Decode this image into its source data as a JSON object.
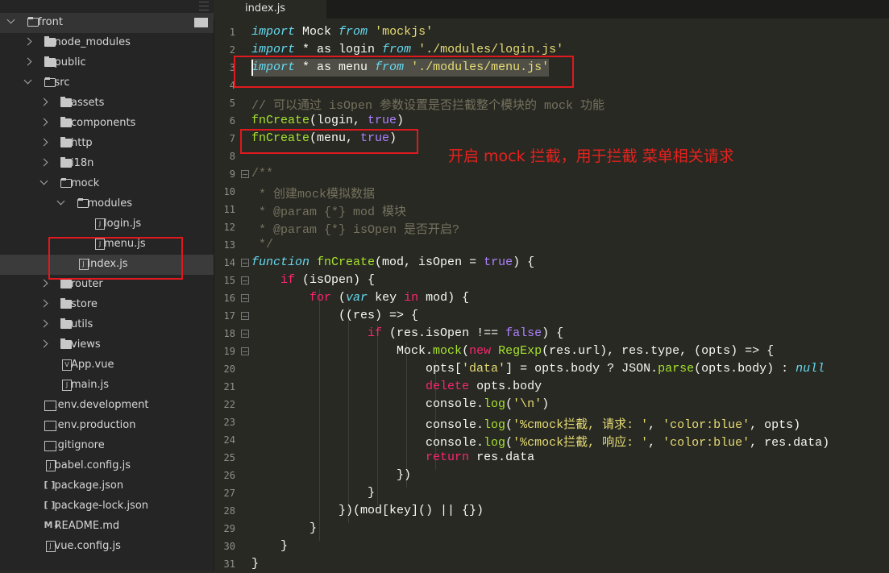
{
  "sidebar": {
    "items": [
      {
        "label": "front",
        "level": 0,
        "kind": "folder-open",
        "chev": "open",
        "state": "root"
      },
      {
        "label": "node_modules",
        "level": 1,
        "kind": "folder",
        "chev": "closed"
      },
      {
        "label": "public",
        "level": 1,
        "kind": "folder",
        "chev": "closed"
      },
      {
        "label": "src",
        "level": 1,
        "kind": "folder-open",
        "chev": "open"
      },
      {
        "label": "assets",
        "level": 2,
        "kind": "folder",
        "chev": "closed"
      },
      {
        "label": "components",
        "level": 2,
        "kind": "folder",
        "chev": "closed"
      },
      {
        "label": "http",
        "level": 2,
        "kind": "folder",
        "chev": "closed"
      },
      {
        "label": "i18n",
        "level": 2,
        "kind": "folder",
        "chev": "closed"
      },
      {
        "label": "mock",
        "level": 2,
        "kind": "folder-open",
        "chev": "open"
      },
      {
        "label": "modules",
        "level": 3,
        "kind": "folder-open",
        "chev": "open"
      },
      {
        "label": "login.js",
        "level": 4,
        "kind": "js"
      },
      {
        "label": "menu.js",
        "level": 4,
        "kind": "js"
      },
      {
        "label": "index.js",
        "level": 3,
        "kind": "js",
        "state": "selected"
      },
      {
        "label": "router",
        "level": 2,
        "kind": "folder",
        "chev": "closed"
      },
      {
        "label": "store",
        "level": 2,
        "kind": "folder",
        "chev": "closed"
      },
      {
        "label": "utils",
        "level": 2,
        "kind": "folder",
        "chev": "closed"
      },
      {
        "label": "views",
        "level": 2,
        "kind": "folder",
        "chev": "closed"
      },
      {
        "label": "App.vue",
        "level": 2,
        "kind": "vue"
      },
      {
        "label": "main.js",
        "level": 2,
        "kind": "js"
      },
      {
        "label": ".env.development",
        "level": 1,
        "kind": "plain"
      },
      {
        "label": ".env.production",
        "level": 1,
        "kind": "plain"
      },
      {
        "label": ".gitignore",
        "level": 1,
        "kind": "plain"
      },
      {
        "label": "babel.config.js",
        "level": 1,
        "kind": "js"
      },
      {
        "label": "package.json",
        "level": 1,
        "kind": "json"
      },
      {
        "label": "package-lock.json",
        "level": 1,
        "kind": "json"
      },
      {
        "label": "README.md",
        "level": 1,
        "kind": "md"
      },
      {
        "label": "vue.config.js",
        "level": 1,
        "kind": "js"
      }
    ]
  },
  "tab": {
    "label": "index.js"
  },
  "editor": {
    "lines": [
      [
        [
          "k",
          "import"
        ],
        [
          "t",
          " Mock "
        ],
        [
          "k",
          "from"
        ],
        [
          "t",
          " "
        ],
        [
          "s",
          "'mockjs'"
        ]
      ],
      [
        [
          "k",
          "import"
        ],
        [
          "t",
          " * as login "
        ],
        [
          "k",
          "from"
        ],
        [
          "t",
          " "
        ],
        [
          "s",
          "'./modules/login.js'"
        ]
      ],
      [
        [
          "k",
          "import"
        ],
        [
          "t",
          " * as menu "
        ],
        [
          "k",
          "from"
        ],
        [
          "t",
          " "
        ],
        [
          "s",
          "'./modules/menu.js'"
        ]
      ],
      [],
      [
        [
          "m",
          "// 可以通过 isOpen 参数设置是否拦截整个模块的 mock 功能"
        ]
      ],
      [
        [
          "f",
          "fnCreate"
        ],
        [
          "t",
          "(login, "
        ],
        [
          "c",
          "true"
        ],
        [
          "t",
          ")"
        ]
      ],
      [
        [
          "f",
          "fnCreate"
        ],
        [
          "t",
          "(menu, "
        ],
        [
          "c",
          "true"
        ],
        [
          "t",
          ")"
        ]
      ],
      [],
      [
        [
          "m",
          "/**"
        ]
      ],
      [
        [
          "m",
          " * 创建mock模拟数据"
        ]
      ],
      [
        [
          "m",
          " * @param {*} mod 模块"
        ]
      ],
      [
        [
          "m",
          " * @param {*} isOpen 是否开启?"
        ]
      ],
      [
        [
          "m",
          " */"
        ]
      ],
      [
        [
          "k",
          "function"
        ],
        [
          "t",
          " "
        ],
        [
          "f",
          "fnCreate"
        ],
        [
          "t",
          "(mod, isOpen = "
        ],
        [
          "c",
          "true"
        ],
        [
          "t",
          ") {"
        ]
      ],
      [
        [
          "t",
          "    "
        ],
        [
          "p",
          "if"
        ],
        [
          "t",
          " (isOpen) {"
        ]
      ],
      [
        [
          "t",
          "        "
        ],
        [
          "p",
          "for"
        ],
        [
          "t",
          " ("
        ],
        [
          "k",
          "var"
        ],
        [
          "t",
          " key "
        ],
        [
          "p",
          "in"
        ],
        [
          "t",
          " mod) {"
        ]
      ],
      [
        [
          "t",
          "            ((res) => {"
        ]
      ],
      [
        [
          "t",
          "                "
        ],
        [
          "p",
          "if"
        ],
        [
          "t",
          " (res.isOpen !== "
        ],
        [
          "c",
          "false"
        ],
        [
          "t",
          ") {"
        ]
      ],
      [
        [
          "t",
          "                    Mock."
        ],
        [
          "f",
          "mock"
        ],
        [
          "t",
          "("
        ],
        [
          "p",
          "new"
        ],
        [
          "t",
          " "
        ],
        [
          "f",
          "RegExp"
        ],
        [
          "t",
          "(res.url), res.type, (opts) => {"
        ]
      ],
      [
        [
          "t",
          "                        opts["
        ],
        [
          "s",
          "'data'"
        ],
        [
          "t",
          "] = opts.body ? JSON."
        ],
        [
          "f",
          "parse"
        ],
        [
          "t",
          "(opts.body) : "
        ],
        [
          "k",
          "null"
        ]
      ],
      [
        [
          "t",
          "                        "
        ],
        [
          "p",
          "delete"
        ],
        [
          "t",
          " opts.body"
        ]
      ],
      [
        [
          "t",
          "                        console."
        ],
        [
          "f",
          "log"
        ],
        [
          "t",
          "("
        ],
        [
          "s",
          "'\\n'"
        ],
        [
          "t",
          ")"
        ]
      ],
      [
        [
          "t",
          "                        console."
        ],
        [
          "f",
          "log"
        ],
        [
          "t",
          "("
        ],
        [
          "s",
          "'%cmock拦截, 请求: '"
        ],
        [
          "t",
          ", "
        ],
        [
          "s",
          "'color:blue'"
        ],
        [
          "t",
          ", opts)"
        ]
      ],
      [
        [
          "t",
          "                        console."
        ],
        [
          "f",
          "log"
        ],
        [
          "t",
          "("
        ],
        [
          "s",
          "'%cmock拦截, 响应: '"
        ],
        [
          "t",
          ", "
        ],
        [
          "s",
          "'color:blue'"
        ],
        [
          "t",
          ", res.data)"
        ]
      ],
      [
        [
          "t",
          "                        "
        ],
        [
          "p",
          "return"
        ],
        [
          "t",
          " res.data"
        ]
      ],
      [
        [
          "t",
          "                    })"
        ]
      ],
      [
        [
          "t",
          "                }"
        ]
      ],
      [
        [
          "t",
          "            })(mod[key]() || {})"
        ]
      ],
      [
        [
          "t",
          "        }"
        ]
      ],
      [
        [
          "t",
          "    }"
        ]
      ],
      [
        [
          "t",
          "}"
        ]
      ]
    ],
    "folds": [
      9,
      14,
      15,
      16,
      17,
      18,
      19
    ],
    "selected_line": 3
  },
  "annotation": {
    "text": "开启 mock 拦截，用于拦截 菜单相关请求",
    "color": "#e8211d"
  },
  "colors": {
    "keyword": "#66d9ef",
    "string": "#e6db74",
    "function": "#a6e22e",
    "constant": "#ae81ff",
    "control": "#f92672",
    "comment": "#75715e",
    "highlight_box": "#e0191e"
  }
}
